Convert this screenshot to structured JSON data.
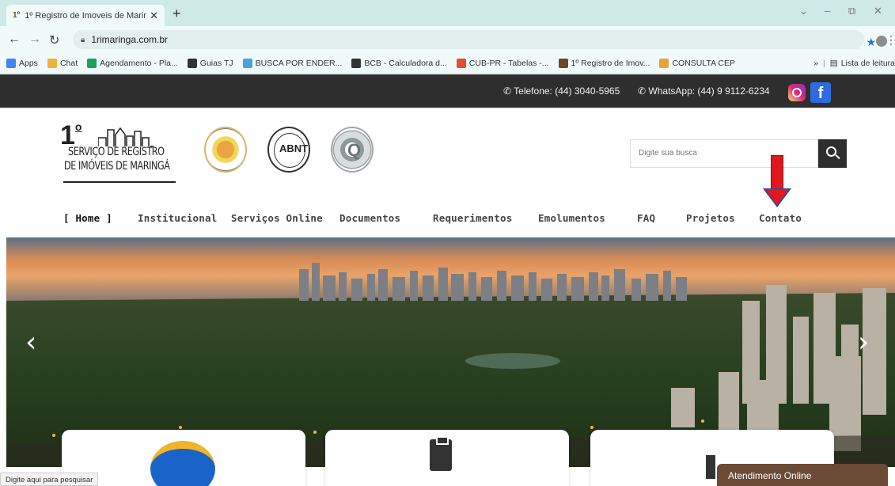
{
  "browser": {
    "tab_title": "1º Registro de Imoveis de Marin",
    "tab_favicon": "1º",
    "url": "1rimaringa.com.br",
    "bookmarks": [
      {
        "label": "Apps",
        "icon": "apps-grid-icon",
        "color": "#4285f4"
      },
      {
        "label": "Chat",
        "icon": "chat-icon",
        "color": "#e9b33c"
      },
      {
        "label": "Agendamento - Pla...",
        "icon": "calendar-icon",
        "color": "#1aa260"
      },
      {
        "label": "Guias TJ",
        "icon": "globe-icon",
        "color": "#333333"
      },
      {
        "label": "BUSCA POR ENDER...",
        "icon": "search-page-icon",
        "color": "#4aa3df"
      },
      {
        "label": "BCB - Calculadora d...",
        "icon": "globe-icon",
        "color": "#333333"
      },
      {
        "label": "CUB-PR - Tabelas -...",
        "icon": "bolt-icon",
        "color": "#e04e39"
      },
      {
        "label": "1º Registro de Imov...",
        "icon": "registry-icon",
        "color": "#6b4a2a"
      },
      {
        "label": "CONSULTA CEP",
        "icon": "cep-icon",
        "color": "#e9a23b"
      }
    ],
    "reading_list": "Lista de leitura",
    "more_bookmarks": "»"
  },
  "topbar": {
    "phone": "Telefone: (44) 3040-5965",
    "whatsapp": "WhatsApp: (44) 9 9112-6234"
  },
  "logo": {
    "number": "1",
    "sup": "o",
    "line1": "SERVIÇO DE REGISTRO",
    "line2": "DE IMÓVEIS DE MARINGÁ"
  },
  "seals": {
    "abnt": "ABNT",
    "q": "Q"
  },
  "search": {
    "placeholder": "Digite sua busca"
  },
  "nav": {
    "items": [
      "[ Home ]",
      "Institucional",
      "Serviços Online",
      "Documentos",
      "Requerimentos",
      "Emolumentos",
      "FAQ",
      "Projetos",
      "Contato"
    ]
  },
  "hero": {
    "prev": "‹",
    "next": "›"
  },
  "chat": {
    "label": "Atendimento Online"
  },
  "status_bar": {
    "text": "Digite aqui para pesquisar"
  },
  "colors": {
    "topbar_bg": "#2e2e2e",
    "annotation_arrow": "#e0181d",
    "chat_bg": "#6b4a36"
  }
}
